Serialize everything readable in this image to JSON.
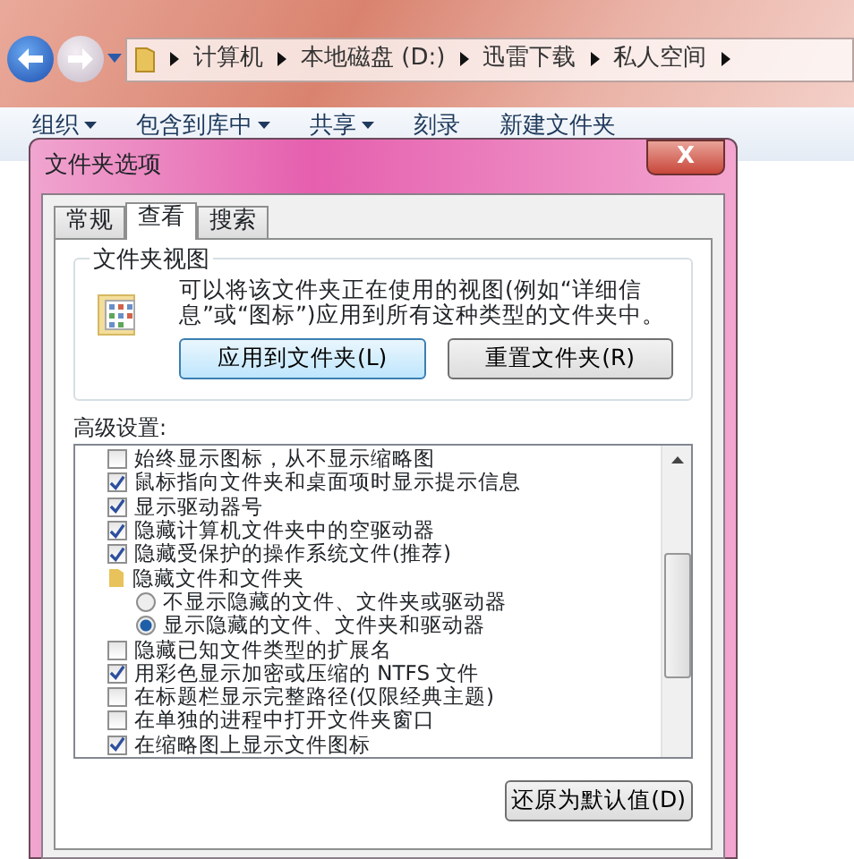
{
  "explorer": {
    "breadcrumb": [
      "计算机",
      "本地磁盘 (D:)",
      "迅雷下载",
      "私人空间"
    ],
    "toolbar": [
      {
        "label": "组织",
        "dropdown": true
      },
      {
        "label": "包含到库中",
        "dropdown": true
      },
      {
        "label": "共享",
        "dropdown": true
      },
      {
        "label": "刻录",
        "dropdown": false
      },
      {
        "label": "新建文件夹",
        "dropdown": false
      }
    ]
  },
  "dialog": {
    "title": "文件夹选项",
    "close": "X",
    "tabs": [
      {
        "label": "常规",
        "selected": false
      },
      {
        "label": "查看",
        "selected": true
      },
      {
        "label": "搜索",
        "selected": false
      }
    ],
    "folder_views": {
      "title": "文件夹视图",
      "description": "可以将该文件夹正在使用的视图(例如“详细信息”或“图标”)应用到所有这种类型的文件夹中。",
      "buttons": [
        {
          "label": "应用到文件夹(L)",
          "focused": true
        },
        {
          "label": "重置文件夹(R)",
          "focused": false
        }
      ]
    },
    "advanced": {
      "label": "高级设置:",
      "items": [
        {
          "kind": "checkbox",
          "label": "始终显示图标，从不显示缩略图",
          "checked": false
        },
        {
          "kind": "checkbox",
          "label": "鼠标指向文件夹和桌面项时显示提示信息",
          "checked": true
        },
        {
          "kind": "checkbox",
          "label": "显示驱动器号",
          "checked": true
        },
        {
          "kind": "checkbox",
          "label": "隐藏计算机文件夹中的空驱动器",
          "checked": true
        },
        {
          "kind": "checkbox",
          "label": "隐藏受保护的操作系统文件(推荐)",
          "checked": true
        },
        {
          "kind": "folder",
          "label": "隐藏文件和文件夹",
          "children": [
            {
              "kind": "radio",
              "label": "不显示隐藏的文件、文件夹或驱动器",
              "selected": false
            },
            {
              "kind": "radio",
              "label": "显示隐藏的文件、文件夹和驱动器",
              "selected": true
            }
          ]
        },
        {
          "kind": "checkbox",
          "label": "隐藏已知文件类型的扩展名",
          "checked": false
        },
        {
          "kind": "checkbox",
          "label": "用彩色显示加密或压缩的 NTFS 文件",
          "checked": true
        },
        {
          "kind": "checkbox",
          "label": "在标题栏显示完整路径(仅限经典主题)",
          "checked": false
        },
        {
          "kind": "checkbox",
          "label": "在单独的进程中打开文件夹窗口",
          "checked": false
        },
        {
          "kind": "checkbox",
          "label": "在缩略图上显示文件图标",
          "checked": true
        }
      ]
    },
    "restore_button": "还原为默认值(D)"
  }
}
